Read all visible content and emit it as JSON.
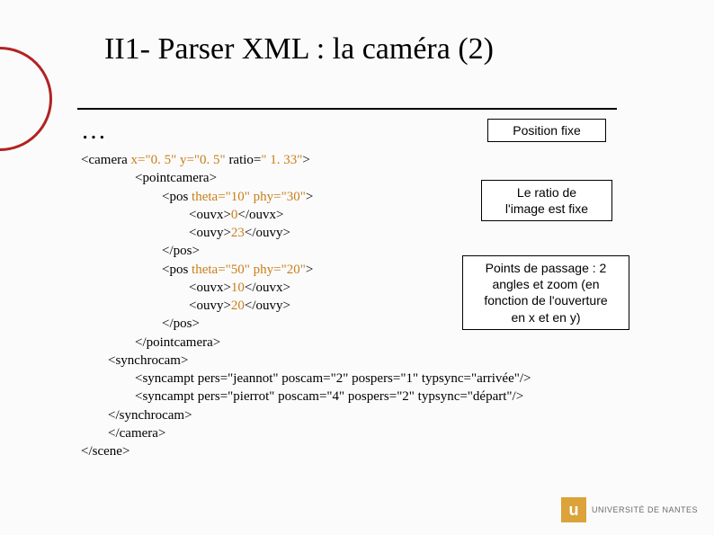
{
  "title": "II1- Parser XML : la caméra (2)",
  "ellipsis": "…",
  "labels": {
    "position_fixe": "Position fixe",
    "ratio_fixed_l1": "Le ratio de",
    "ratio_fixed_l2": "l'image est fixe",
    "waypoints_l1": "Points de passage : 2",
    "waypoints_l2": "angles et zoom (en",
    "waypoints_l3": "fonction de l'ouverture",
    "waypoints_l4": "en x et en y)"
  },
  "code": {
    "l01a": "<camera ",
    "l01b": "x=\"0. 5\" y=\"0. 5\"",
    "l01c": " ratio=",
    "l01d": "\" 1. 33\"",
    "l01e": ">",
    "l02": "<pointcamera>",
    "l03a": "<pos ",
    "l03b": "theta=\"10\" phy=\"30\"",
    "l03c": ">",
    "l04a": "<ouvx>",
    "l04b": "0",
    "l04c": "</ouvx>",
    "l05a": "<ouvy>",
    "l05b": "23",
    "l05c": "</ouvy>",
    "l06": "</pos>",
    "l07a": "<pos ",
    "l07b": "theta=\"50\" phy=\"20\"",
    "l07c": ">",
    "l08a": "<ouvx>",
    "l08b": "10",
    "l08c": "</ouvx>",
    "l09a": "<ouvy>",
    "l09b": "20",
    "l09c": "</ouvy>",
    "l10": "</pos>",
    "l11": "</pointcamera>",
    "l12": "<synchrocam>",
    "l13": "<syncampt pers=\"jeannot\" poscam=\"2\" pospers=\"1\" typsync=\"arrivée\"/>",
    "l14": "<syncampt pers=\"pierrot\" poscam=\"4\" pospers=\"2\" typsync=\"départ\"/>",
    "l15": "</synchrocam>",
    "l16": "</camera>",
    "l17": "</scene>"
  },
  "logo": {
    "glyph": "u",
    "text": "UNIVERSITÉ DE NANTES"
  }
}
